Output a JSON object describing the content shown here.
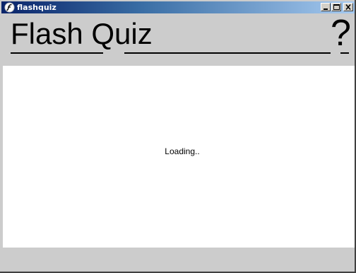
{
  "window": {
    "title": "flashquiz",
    "minimize_label": "_",
    "maximize_label": "□",
    "close_label": "×"
  },
  "header": {
    "title": "Flash Quiz",
    "help_label": "?"
  },
  "content": {
    "status": "Loading.."
  },
  "colors": {
    "titlebar_start": "#0a246a",
    "titlebar_end": "#a6caf0",
    "chrome": "#cccccc",
    "content_bg": "#ffffff"
  }
}
